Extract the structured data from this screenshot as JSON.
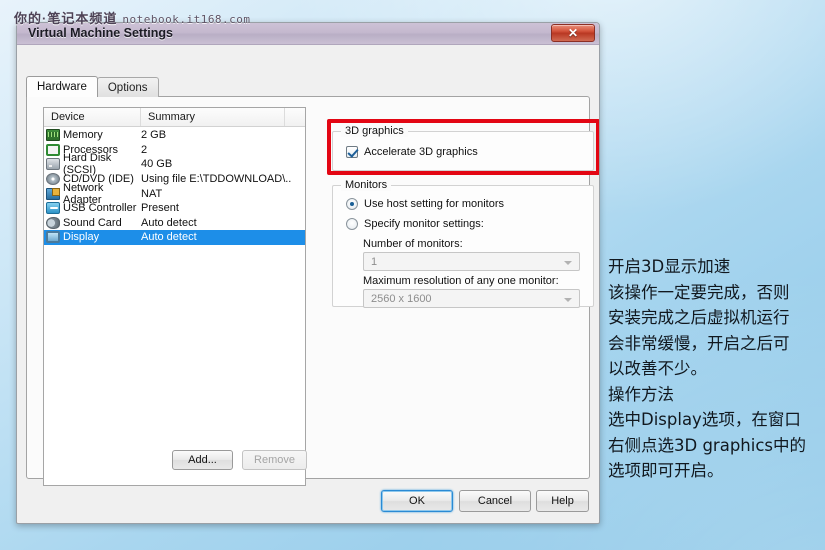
{
  "watermark": {
    "cn": "你的·笔记本频道",
    "en": "notebook.it168.com"
  },
  "dialog": {
    "title": "Virtual Machine Settings",
    "close_label": "✕"
  },
  "tabs": [
    {
      "label": "Hardware",
      "active": true
    },
    {
      "label": "Options",
      "active": false
    }
  ],
  "device_list": {
    "columns": [
      "Device",
      "Summary",
      ""
    ],
    "rows": [
      {
        "icon": "memory-icon",
        "device": "Memory",
        "summary": "2 GB",
        "selected": false
      },
      {
        "icon": "processor-icon",
        "device": "Processors",
        "summary": "2",
        "selected": false
      },
      {
        "icon": "hard-disk-icon",
        "device": "Hard Disk (SCSI)",
        "summary": "40 GB",
        "selected": false
      },
      {
        "icon": "cd-dvd-icon",
        "device": "CD/DVD (IDE)",
        "summary": "Using file E:\\TDDOWNLOAD\\..",
        "selected": false
      },
      {
        "icon": "network-adapter-icon",
        "device": "Network Adapter",
        "summary": "NAT",
        "selected": false
      },
      {
        "icon": "usb-controller-icon",
        "device": "USB Controller",
        "summary": "Present",
        "selected": false
      },
      {
        "icon": "sound-card-icon",
        "device": "Sound Card",
        "summary": "Auto detect",
        "selected": false
      },
      {
        "icon": "display-icon",
        "device": "Display",
        "summary": "Auto detect",
        "selected": true
      }
    ],
    "add_label": "Add...",
    "remove_label": "Remove"
  },
  "settings": {
    "graphics_group": {
      "legend": "3D graphics",
      "accelerate_label": "Accelerate 3D graphics",
      "accelerate_checked": true
    },
    "monitors_group": {
      "legend": "Monitors",
      "use_host_label": "Use host setting for monitors",
      "use_host_selected": true,
      "specify_label": "Specify monitor settings:",
      "specify_selected": false,
      "number_label": "Number of monitors:",
      "number_value": "1",
      "max_res_label": "Maximum resolution of any one monitor:",
      "max_res_value": "2560 x 1600"
    }
  },
  "footer": {
    "ok_label": "OK",
    "cancel_label": "Cancel",
    "help_label": "Help"
  },
  "annotation": {
    "line1": "开启3D显示加速",
    "line2": "该操作一定要完成，否则",
    "line3": "安装完成之后虚拟机运行",
    "line4": "会非常缓慢，开启之后可",
    "line5": "以改善不少。",
    "line6": "操作方法",
    "line7": "选中Display选项，在窗口",
    "line8": "右侧点选3D graphics中的",
    "line9": "选项即可开启。"
  },
  "colors": {
    "highlight_box": "#e30613",
    "selection": "#1d8ee8",
    "titlebar": "#c4b8ce"
  }
}
